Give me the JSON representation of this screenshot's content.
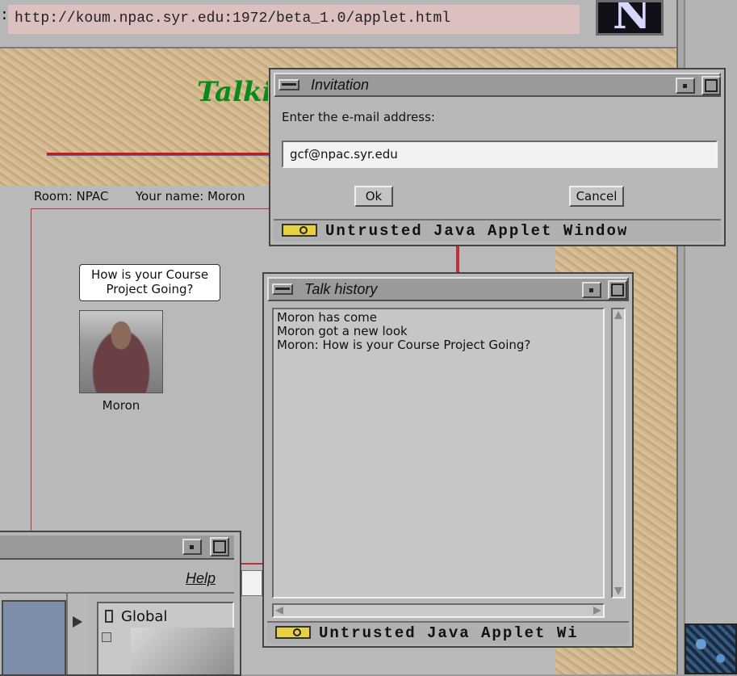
{
  "browser": {
    "url_prefix": ":",
    "url": "http://koum.npac.syr.edu:1972/beta_1.0/applet.html",
    "logo_letter": "N"
  },
  "page": {
    "title_fragment": "Talki"
  },
  "applet": {
    "room_label": "Room: NPAC",
    "name_label": "Your name: Moron",
    "bubble_text": "How is your Course Project Going?",
    "avatar_name": "Moron"
  },
  "invitation": {
    "title": "Invitation",
    "prompt": "Enter the e-mail address:",
    "email_value": "gcf@npac.syr.edu",
    "ok_label": "Ok",
    "cancel_label": "Cancel",
    "footer": "Untrusted Java Applet Window"
  },
  "history": {
    "title": "Talk history",
    "lines": [
      "Moron has come",
      "Moron got a new look",
      "Moron: How is your Course Project Going?"
    ],
    "footer": "Untrusted Java Applet Wi"
  },
  "bottom_window": {
    "help_label": "Help",
    "list_item": "Global"
  },
  "colors": {
    "title_green": "#0a8a1a",
    "accent_red": "#c0303a",
    "url_field_bg": "#dcbfbf"
  }
}
